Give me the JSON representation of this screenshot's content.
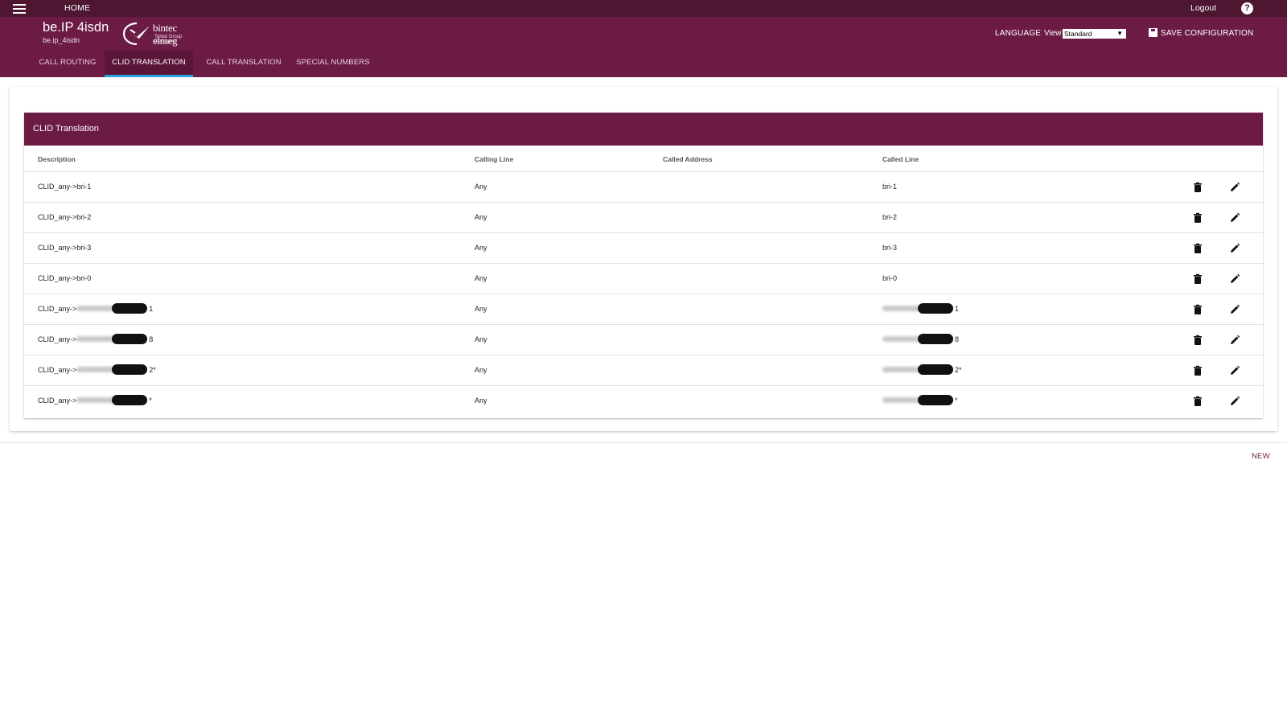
{
  "topbar": {
    "home_label": "HOME",
    "logout_label": "Logout",
    "help_icon": "?"
  },
  "header": {
    "device_title": "be.IP 4isdn",
    "device_subtitle": "be.ip_4isdn",
    "logo": {
      "brand": "bintec elmeg",
      "tagline": "Teldat Group Company"
    },
    "language_label": "LANGUAGE",
    "view_label": "View",
    "view_value": "Standard",
    "save_label": "SAVE CONFIGURATION"
  },
  "tabs": [
    {
      "label": "CALL ROUTING",
      "active": false
    },
    {
      "label": "CLID TRANSLATION",
      "active": true
    },
    {
      "label": "CALL TRANSLATION",
      "active": false
    },
    {
      "label": "SPECIAL NUMBERS",
      "active": false
    }
  ],
  "panel": {
    "title": "CLID Translation",
    "columns": [
      "Description",
      "Calling Line",
      "Called Address",
      "Called Line"
    ],
    "rows": [
      {
        "description": "CLID_any->bri-1",
        "calling_line": "Any",
        "called_address": "",
        "called_line": "bri-1"
      },
      {
        "description": "CLID_any->bri-2",
        "calling_line": "Any",
        "called_address": "",
        "called_line": "bri-2"
      },
      {
        "description": "CLID_any->bri-3",
        "calling_line": "Any",
        "called_address": "",
        "called_line": "bri-3"
      },
      {
        "description": "CLID_any->bri-0",
        "calling_line": "Any",
        "called_address": "",
        "called_line": "bri-0"
      },
      {
        "description": "CLID_any->",
        "description_suffix": "1",
        "calling_line": "Any",
        "called_address": "",
        "called_line": "",
        "called_line_suffix": "1"
      },
      {
        "description": "CLID_any->",
        "description_suffix": "8",
        "calling_line": "Any",
        "called_address": "",
        "called_line": "",
        "called_line_suffix": "8"
      },
      {
        "description": "CLID_any->",
        "description_suffix": "2*",
        "calling_line": "Any",
        "called_address": "",
        "called_line": "",
        "called_line_suffix": "2*"
      },
      {
        "description": "CLID_any->",
        "description_suffix": "*",
        "calling_line": "Any",
        "called_address": "",
        "called_line": "",
        "called_line_suffix": "*"
      }
    ]
  },
  "footer": {
    "new_label": "NEW"
  },
  "colors": {
    "header_bg": "#6c1b45",
    "topbar_bg": "#4e1631",
    "tab_indicator": "#26a4d9"
  }
}
